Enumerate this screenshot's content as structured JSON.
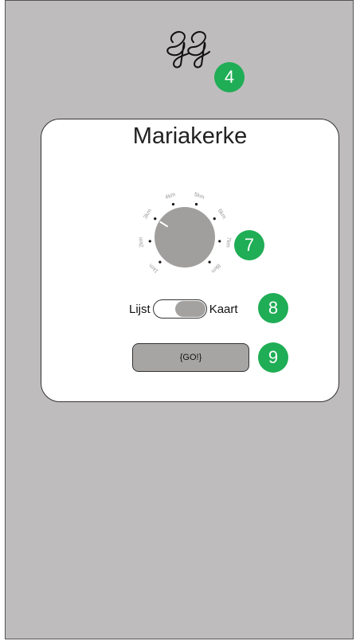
{
  "logo": {
    "text": "GG",
    "icon": "gg-script-logo"
  },
  "badges": {
    "logo": "4",
    "dial": "7",
    "toggle": "8",
    "go": "9"
  },
  "location": {
    "name": "Mariakerke"
  },
  "distance_dial": {
    "labels": [
      "1km",
      "2km",
      "3km",
      "4km",
      "5km",
      "6km",
      "7km",
      "8km"
    ],
    "selected": "3km"
  },
  "view_toggle": {
    "left_label": "Lijst",
    "right_label": "Kaart",
    "active": "Kaart"
  },
  "go_button": {
    "label": "{GO!}"
  },
  "colors": {
    "background": "#bebcbd",
    "card": "#ffffff",
    "badge": "#1fad55",
    "dial": "#a19f9e",
    "button": "#a6a5a4"
  }
}
